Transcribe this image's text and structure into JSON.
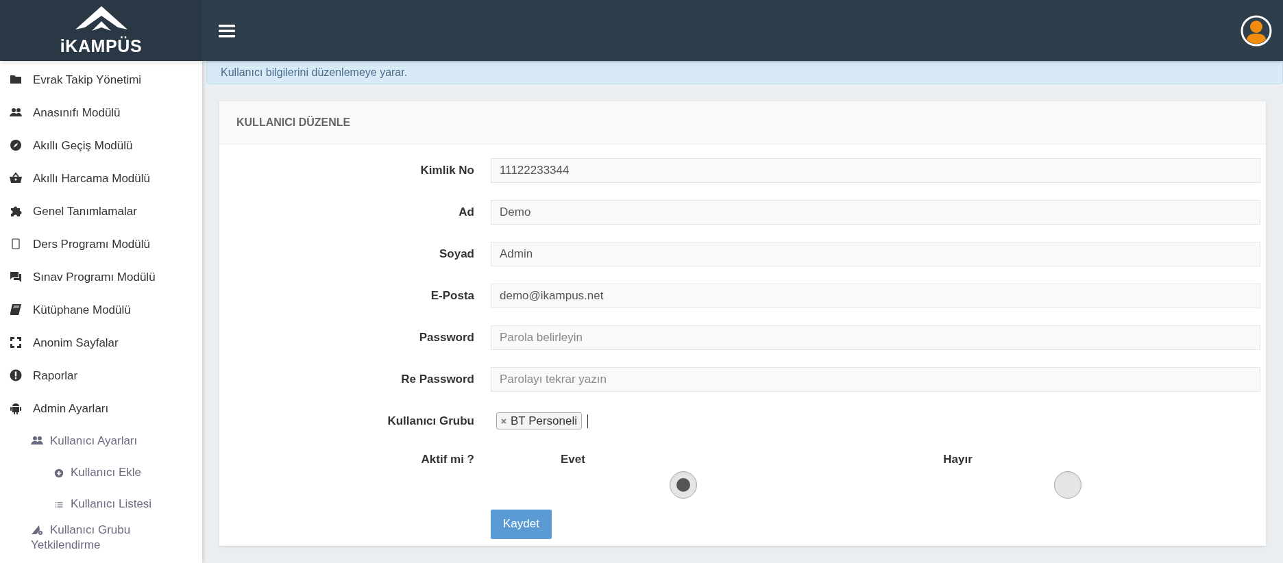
{
  "header": {
    "logo_text": "iKAMPÜS"
  },
  "sidebar": {
    "items": [
      {
        "label": "Evrak Takip Yönetimi"
      },
      {
        "label": "Anasınıfı Modülü"
      },
      {
        "label": "Akıllı Geçiş Modülü"
      },
      {
        "label": "Akıllı Harcama Modülü"
      },
      {
        "label": "Genel Tanımlamalar"
      },
      {
        "label": "Ders Programı Modülü"
      },
      {
        "label": "Sınav Programı Modülü"
      },
      {
        "label": "Kütüphane Modülü"
      },
      {
        "label": "Anonim Sayfalar"
      },
      {
        "label": "Raporlar"
      },
      {
        "label": "Admin Ayarları",
        "children": [
          {
            "label": "Kullanıcı Ayarları",
            "children": [
              {
                "label": "Kullanıcı Ekle"
              },
              {
                "label": "Kullanıcı Listesi"
              }
            ]
          },
          {
            "label": "Kullanıcı Grubu Yetkilendirme"
          }
        ]
      }
    ]
  },
  "info": {
    "text": "Kullanıcı bilgilerini düzenlemeye yarar."
  },
  "form": {
    "title": "KULLANICI DÜZENLE",
    "fields": [
      {
        "kind": "text",
        "label": "Kimlik No",
        "value": "11122233344"
      },
      {
        "kind": "text",
        "label": "Ad",
        "value": "Demo"
      },
      {
        "kind": "text",
        "label": "Soyad",
        "value": "Admin"
      },
      {
        "kind": "text",
        "label": "E-Posta",
        "value": "demo@ikampus.net"
      },
      {
        "kind": "text",
        "label": "Password",
        "placeholder": "Parola belirleyin"
      },
      {
        "kind": "text",
        "label": "Re Password",
        "placeholder": "Parolayı tekrar yazın"
      },
      {
        "kind": "tags",
        "label": "Kullanıcı Grubu",
        "tags": [
          "BT Personeli"
        ]
      },
      {
        "kind": "radio",
        "label": "Aktif mi ?",
        "options": [
          {
            "label": "Evet",
            "selected": true
          },
          {
            "label": "Hayır",
            "selected": false
          }
        ]
      }
    ],
    "submit": "Kaydet"
  }
}
